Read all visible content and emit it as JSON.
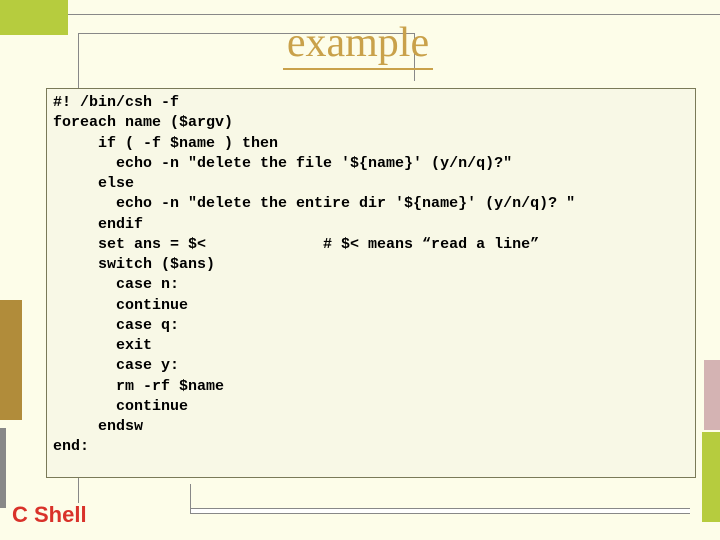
{
  "title": "example",
  "footer": "C Shell",
  "code": "#! /bin/csh -f\nforeach name ($argv)\n     if ( -f $name ) then\n       echo -n \"delete the file '${name}' (y/n/q)?\"\n     else\n       echo -n \"delete the entire dir '${name}' (y/n/q)? \"\n     endif\n     set ans = $<             # $< means “read a line”\n     switch ($ans)\n       case n:\n       continue\n       case q:\n       exit\n       case y:\n       rm -rf $name\n       continue\n     endsw\nend:"
}
